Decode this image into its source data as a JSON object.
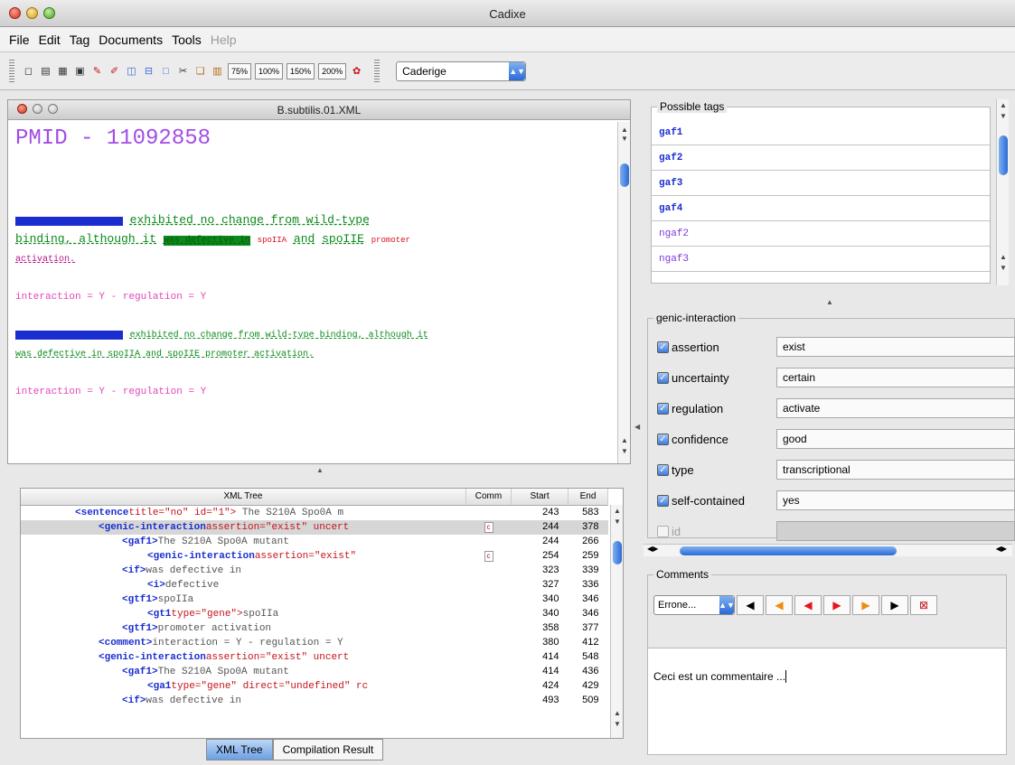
{
  "window": {
    "title": "Cadixe"
  },
  "menu": [
    "File",
    "Edit",
    "Tag",
    "Documents",
    "Tools",
    "Help"
  ],
  "toolbar": {
    "zoom": [
      "75%",
      "100%",
      "150%",
      "200%"
    ],
    "tool": "Caderige"
  },
  "document": {
    "title": "B.subtilis.01.XML",
    "pmid": "PMID - 11092858",
    "lines": [
      {
        "parts": [
          "exhibited no change from wild-type"
        ]
      },
      {
        "parts": [
          "binding, although it",
          "was defective in",
          "spoIIA",
          "and",
          "spoIIE",
          "promoter"
        ]
      },
      {
        "parts": [
          "activation."
        ]
      },
      {
        "parts": [
          "interaction = Y - regulation = Y"
        ]
      },
      {
        "parts": [
          "exhibited no change from wild-type binding, although it"
        ]
      },
      {
        "parts": [
          "was defective in spoIIA and spoIIE promoter activation."
        ]
      },
      {
        "parts": [
          "interaction = Y - regulation = Y"
        ]
      }
    ]
  },
  "tree": {
    "headers": [
      "XML Tree",
      "Comm",
      "Start",
      "End"
    ],
    "rows": [
      {
        "el": "<sentence",
        "attr": "title=\"no\" id=\"1\">",
        "text": " The S210A Spo0A m",
        "start": "243",
        "end": "583"
      },
      {
        "el": "<genic-interaction",
        "attr": "assertion=\"exist\" uncert",
        "text": "",
        "start": "244",
        "end": "378",
        "comm": true,
        "sel": true
      },
      {
        "el": "<gaf1>",
        "attr": "",
        "text": "The S210A Spo0A mutant",
        "start": "244",
        "end": "266"
      },
      {
        "el": "<genic-interaction",
        "attr": "assertion=\"exist\"",
        "text": "",
        "start": "254",
        "end": "259",
        "comm": true
      },
      {
        "el": "<if>",
        "attr": "",
        "text": "was defective in",
        "start": "323",
        "end": "339"
      },
      {
        "el": "<i>",
        "attr": "",
        "text": "defective",
        "start": "327",
        "end": "336"
      },
      {
        "el": "<gtf1>",
        "attr": "",
        "text": "spoIIa",
        "start": "340",
        "end": "346"
      },
      {
        "el": "<gt1",
        "attr": "type=\"gene\">",
        "text": "spoIIa",
        "start": "340",
        "end": "346"
      },
      {
        "el": "<gtf1>",
        "attr": "",
        "text": "promoter activation",
        "start": "358",
        "end": "377"
      },
      {
        "el": "<comment>",
        "attr": "",
        "text": "interaction = Y - regulation = Y",
        "start": "380",
        "end": "412"
      },
      {
        "el": "<genic-interaction",
        "attr": "assertion=\"exist\" uncert",
        "text": "",
        "start": "414",
        "end": "548"
      },
      {
        "el": "<gaf1>",
        "attr": "",
        "text": "The S210A Spo0A mutant",
        "start": "414",
        "end": "436"
      },
      {
        "el": "<ga1",
        "attr": "type=\"gene\" direct=\"undefined\" rc",
        "text": "",
        "start": "424",
        "end": "429"
      },
      {
        "el": "<if>",
        "attr": "",
        "text": "was defective in",
        "start": "493",
        "end": "509"
      }
    ]
  },
  "tabs": [
    "XML Tree",
    "Compilation Result"
  ],
  "possible_tags": {
    "label": "Possible tags",
    "items": [
      "gaf1",
      "gaf2",
      "gaf3",
      "gaf4",
      "ngaf2",
      "ngaf3"
    ]
  },
  "genic": {
    "label": "genic-interaction",
    "fields": [
      {
        "name": "assertion",
        "value": "exist",
        "checked": true
      },
      {
        "name": "uncertainty",
        "value": "certain",
        "checked": true
      },
      {
        "name": "regulation",
        "value": "activate",
        "checked": true
      },
      {
        "name": "confidence",
        "value": "good",
        "checked": true
      },
      {
        "name": "type",
        "value": "transcriptional",
        "checked": true
      },
      {
        "name": "self-contained",
        "value": "yes",
        "checked": true
      },
      {
        "name": "id",
        "value": "",
        "checked": false
      }
    ]
  },
  "comments": {
    "label": "Comments",
    "type": "Errone...",
    "text": "Ceci est un commentaire ..."
  }
}
